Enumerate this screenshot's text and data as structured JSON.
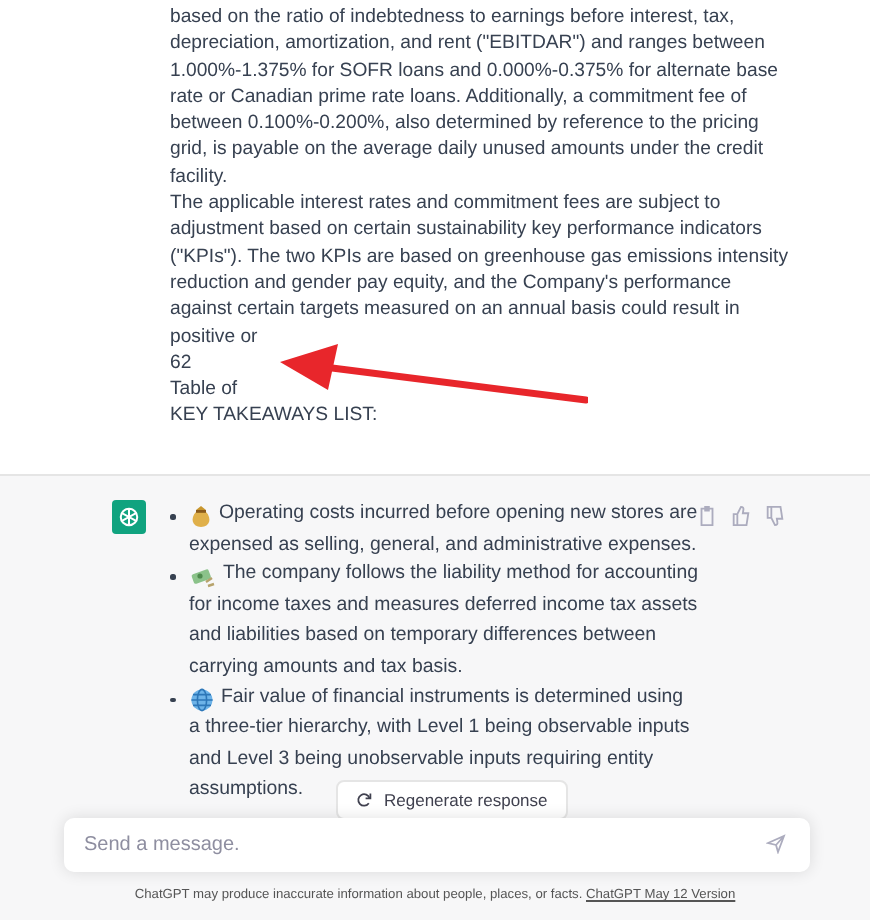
{
  "user_message": {
    "paragraphs": [
      "based on the ratio of indebtedness to earnings before interest, tax, depreciation, amortization, and rent (\"EBITDAR\") and ranges between 1.000%-1.375% for SOFR loans and 0.000%-0.375% for alternate base rate or Canadian prime rate loans. Additionally, a commitment fee of between 0.100%-0.200%, also determined by reference to the pricing grid, is payable on the average daily unused amounts under the credit facility.",
      "The applicable interest rates and commitment fees are subject to adjustment based on certain sustainability key performance indicators (\"KPIs\"). The two KPIs are based on greenhouse gas emissions intensity reduction and gender pay equity, and the Company's performance against certain targets measured on an annual basis could result in positive or",
      "62",
      "Table of",
      "KEY TAKEAWAYS LIST:"
    ]
  },
  "response": {
    "bullets": [
      {
        "text": "Operating costs incurred before opening new stores are expensed as selling, general, and administrative expenses."
      },
      {
        "text": "The company follows the liability method for accounting for income taxes and measures deferred income tax assets and liabilities based on temporary differences between carrying amounts and tax basis."
      },
      {
        "text": "Fair value of financial instruments is determined using a three-tier hierarchy, with Level 1 being observable inputs and Level 3 being unobservable inputs requiring entity assumptions."
      }
    ]
  },
  "regenerate_button": {
    "label": "Regenerate response"
  },
  "composer": {
    "placeholder": "Send a message."
  },
  "footer": {
    "text": "ChatGPT may produce inaccurate information about people, places, or facts.",
    "link": "ChatGPT May 12 Version"
  }
}
